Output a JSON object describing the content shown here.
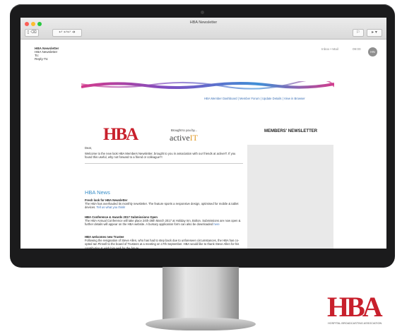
{
  "window": {
    "title": "HBA Newsletter"
  },
  "email": {
    "sender_name": "HBA Newsletter",
    "sender_address": "HBA Newsletter",
    "to_label": "To:",
    "reply_label": "Reply-To:",
    "inbox_label": "Inbox • Mail",
    "time": "09:00",
    "avatar": "HN"
  },
  "newsletter": {
    "links": "HBA Member Dashboard | Member Forum | Update Details | View in Browser",
    "brought_by": "Brought to you by...",
    "partner_logo": "activeIT",
    "members_title": "MEMBERS' NEWSLETTER",
    "greeting": "Dear,",
    "intro": "Welcome to the new look HBA Members Newsletter, brought to you in association with our friends at activeIT. If you found this useful, why not forward to a friend or colleague?!",
    "news_heading": "HBA News",
    "items": [
      {
        "title": "Fresh look for HBA Newsletter",
        "text": "The HBA has overhauled its monthly newsletter. The feature sports a responsive design, optimised for mobile & tablet devices.",
        "link": "Tell us what you think!"
      },
      {
        "title": "HBA Conference & Awards 2017 Submissions Open",
        "text": "The HBA Annual Conference will take place 24th-26th March 2017 at Holiday Inn, Bolton. Submissions are now open & further details will appear on the HBA website. A bursary application form can also be downloaded",
        "link": "here"
      },
      {
        "title": "HBA welcomes new Trustee",
        "text": "Following the resignation of Steve Allen, who has had to step back due to unforeseen circumstances, the HBA has co-opted Ian Pinnell to the board of Trustees at a meeting on 17th September. HBA would like to thank Steve Allen for his contribution & wish him well for the future.",
        "link": ""
      }
    ]
  },
  "corner_logo": {
    "text": "HBA",
    "subtitle": "HOSPITAL BROADCASTING ASSOCIATION"
  },
  "colors": {
    "brand_red": "#c8202c",
    "link_blue": "#3a6fb5"
  }
}
